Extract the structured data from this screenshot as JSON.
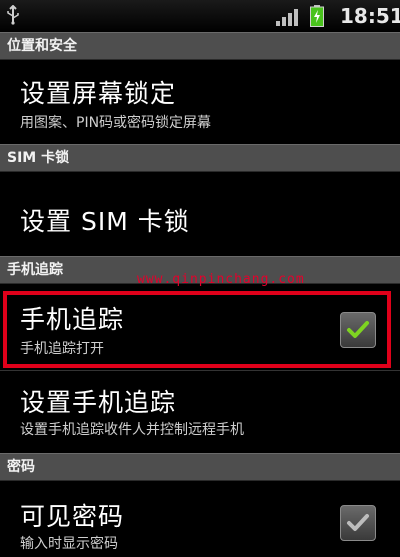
{
  "status_bar": {
    "time": "18:51",
    "icons": [
      "usb-icon",
      "signal-icon",
      "battery-charging-icon"
    ],
    "colors": {
      "battery": "#49c21c"
    }
  },
  "sections": [
    {
      "header": "位置和安全",
      "items": [
        {
          "title": "设置屏幕锁定",
          "subtitle": "用图案、PIN码或密码锁定屏幕"
        }
      ]
    },
    {
      "header": "SIM 卡锁",
      "items": [
        {
          "title": "设置 SIM 卡锁"
        }
      ]
    },
    {
      "header": "手机追踪",
      "items": [
        {
          "title": "手机追踪",
          "subtitle": "手机追踪打开",
          "checked": true,
          "highlighted": true
        },
        {
          "title": "设置手机追踪",
          "subtitle": "设置手机追踪收件人并控制远程手机"
        }
      ]
    },
    {
      "header": "密码",
      "items": [
        {
          "title": "可见密码",
          "subtitle": "输入时显示密码",
          "checked": true
        }
      ]
    }
  ],
  "watermark": "www.qinpinchang.com",
  "colors": {
    "highlight_border": "#e0001a",
    "check_green": "#7ed321",
    "header_bg": "#4e4e4e"
  }
}
